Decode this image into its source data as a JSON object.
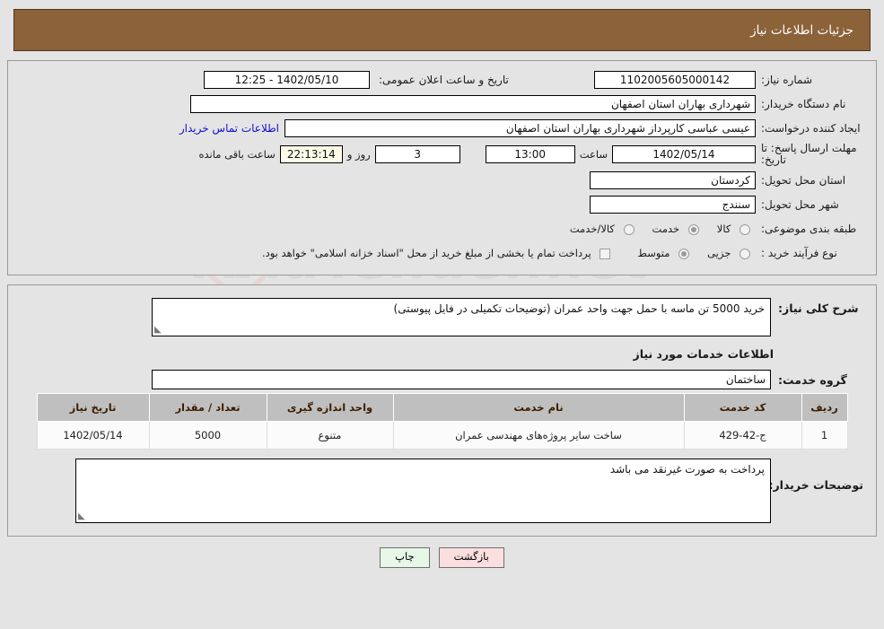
{
  "header": {
    "title": "جزئیات اطلاعات نیاز"
  },
  "watermark": {
    "text": "AriaTender.net",
    "shield_icon": "shield-icon"
  },
  "top": {
    "need_number_label": "شماره نیاز:",
    "need_number_value": "1102005605000142",
    "announce_label": "تاریخ و ساعت اعلان عمومی:",
    "announce_value": "1402/05/10 - 12:25",
    "buyer_org_label": "نام دستگاه خریدار:",
    "buyer_org_value": "شهرداری بهاران استان اصفهان",
    "creator_label": "ایجاد کننده درخواست:",
    "creator_value": "عیسی عباسی کارپرداز شهرداری بهاران استان اصفهان",
    "contact_link": "اطلاعات تماس خریدار",
    "deadline_label": "مهلت ارسال پاسخ: تا تاریخ:",
    "deadline_date": "1402/05/14",
    "time_label": "ساعت",
    "deadline_time": "13:00",
    "days_value": "3",
    "days_label": "روز و",
    "countdown_value": "22:13:14",
    "remaining_label": "ساعت باقی مانده",
    "province_label": "استان محل تحویل:",
    "province_value": "کردستان",
    "city_label": "شهر محل تحویل:",
    "city_value": "سنندج",
    "category_label": "طبقه بندی موضوعی:",
    "category_options": [
      "کالا",
      "خدمت",
      "کالا/خدمت"
    ],
    "category_selected": "خدمت",
    "process_label": "نوع فرآیند خرید :",
    "process_options": [
      "جزیی",
      "متوسط"
    ],
    "process_selected": "متوسط",
    "treasury_checkbox_label": "پرداخت تمام یا بخشی از مبلغ خرید از محل \"اسناد خزانه اسلامی\" خواهد بود.",
    "treasury_checked": false
  },
  "bottom": {
    "summary_label": "شرح کلی نیاز:",
    "summary_value": "خرید 5000 تن ماسه با حمل جهت واحد عمران (توضیحات تکمیلی در فایل پیوستی)",
    "services_section_title": "اطلاعات خدمات مورد نیاز",
    "service_group_label": "گروه خدمت:",
    "service_group_value": "ساختمان",
    "table": {
      "headers": [
        "ردیف",
        "کد خدمت",
        "نام خدمت",
        "واحد اندازه گیری",
        "تعداد / مقدار",
        "تاریخ نیاز"
      ],
      "rows": [
        [
          "1",
          "ج-42-429",
          "ساخت سایر پروژه‌های مهندسی عمران",
          "متنوع",
          "5000",
          "1402/05/14"
        ]
      ]
    },
    "buyer_notes_label": "توضیحات خریدار:",
    "buyer_notes_value": "پرداخت به صورت غیرنقد می باشد"
  },
  "footer": {
    "back_button": "بازگشت",
    "print_button": "چاپ"
  }
}
